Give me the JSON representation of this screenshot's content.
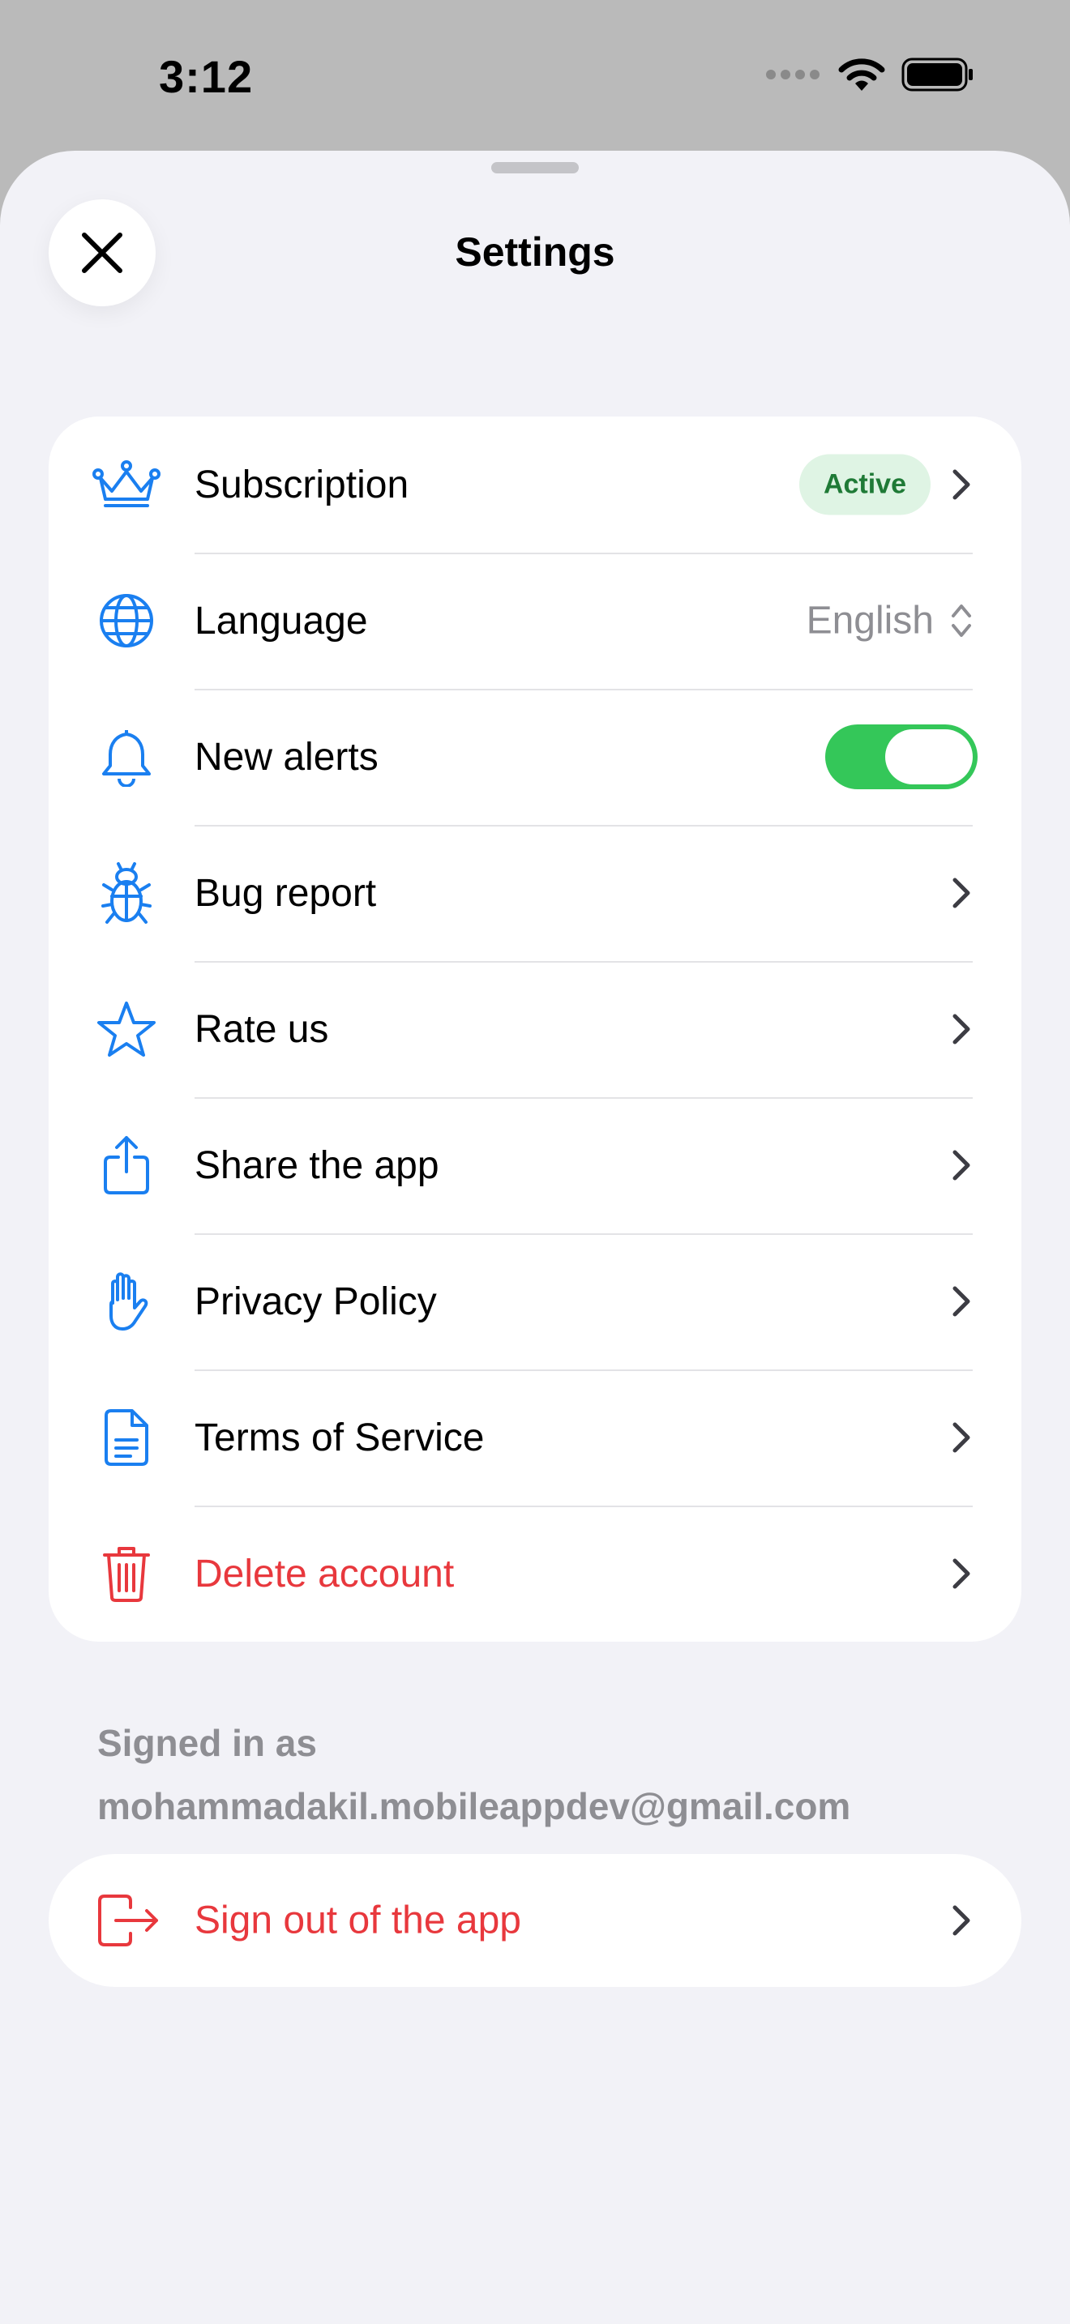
{
  "status_bar": {
    "time": "3:12",
    "icons": [
      "signal-dots-icon",
      "wifi-icon",
      "battery-icon"
    ]
  },
  "sheet": {
    "title": "Settings",
    "close_icon": "close-icon"
  },
  "settings": [
    {
      "id": "subscription",
      "label": "Subscription",
      "icon": "crown-icon",
      "badge": "Active"
    },
    {
      "id": "language",
      "label": "Language",
      "icon": "globe-icon",
      "value": "English"
    },
    {
      "id": "new-alerts",
      "label": "New alerts",
      "icon": "bell-icon",
      "toggle_on": true
    },
    {
      "id": "bug-report",
      "label": "Bug report",
      "icon": "ladybug-icon"
    },
    {
      "id": "rate-us",
      "label": "Rate us",
      "icon": "star-icon"
    },
    {
      "id": "share-app",
      "label": "Share the app",
      "icon": "share-icon"
    },
    {
      "id": "privacy-policy",
      "label": "Privacy Policy",
      "icon": "hand-icon"
    },
    {
      "id": "terms",
      "label": "Terms of Service",
      "icon": "document-icon"
    },
    {
      "id": "delete-account",
      "label": "Delete account",
      "icon": "trash-icon"
    }
  ],
  "account": {
    "signed_in_label": "Signed in as",
    "email": "mohammadakil.mobileappdev@gmail.com",
    "sign_out_label": "Sign out of the app",
    "sign_out_icon": "sign-out-icon"
  },
  "colors": {
    "accent": "#1a7ff0",
    "destructive": "#e8383d",
    "toggle_on": "#34c759",
    "badge_bg": "#dff4e4",
    "badge_text": "#1f7a36",
    "sheet_bg": "#f2f2f7"
  }
}
